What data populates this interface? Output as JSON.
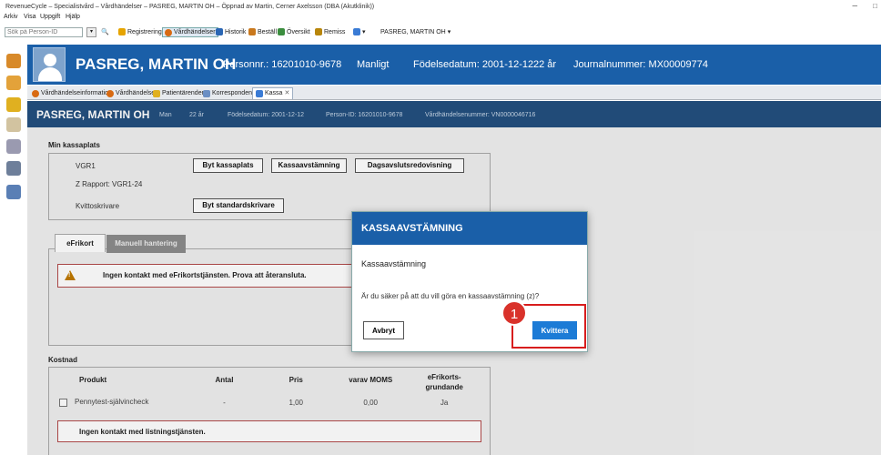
{
  "window": {
    "title": "RevenueCycle – Specialistvård – Vårdhändelser – PASREG, MARTIN OH – Öppnad av Martin, Cerner Axelsson (DBA (Akutklinik))",
    "minimize": "–",
    "close": "□"
  },
  "menu": [
    "Arkiv",
    "Visa",
    "Uppgift",
    "Hjälp"
  ],
  "toolbar": {
    "search_placeholder": "Sök på Person-ID",
    "dropdown": "▾",
    "buttons": [
      "Registrering",
      "Vårdhändelser",
      "Historik",
      "Beställ",
      "Översikt",
      "Remiss",
      "▾",
      "PASREG, MARTIN OH",
      "▾"
    ],
    "colors": [
      "#e6a400",
      "#d86a12",
      "#2a66b4",
      "#c9781d",
      "#3b8d3e",
      "#b8860b",
      "#3a7bd5"
    ]
  },
  "patient": {
    "name": "PASREG, MARTIN OH",
    "personnr": "Personnr.: 16201010-9678",
    "gender": "Manligt",
    "birth": "Födelsedatum: 2001-12-12",
    "age": "22 år",
    "journal": "Journalnummer: MX00009774"
  },
  "tabs": [
    "Vårdhändelseinformation",
    "Vårdhändelser",
    "Patientärenden",
    "Korrespondens",
    "Kassa",
    "✕"
  ],
  "subheader": {
    "name": "PASREG, MARTIN OH",
    "gender": "Man",
    "age": "22 år",
    "birth": "Födelsedatum: 2001-12-12",
    "personid": "Person-ID: 16201010-9678",
    "vardhandelse": "Vårdhändelsenummer: VN0000046716"
  },
  "kassaplats": {
    "title": "Min kassaplats",
    "vgr": "VGR1",
    "zrapport": "Z Rapport: VGR1-24",
    "kvittoskrivare": "Kvittoskrivare",
    "btn_byt": "Byt kassaplats",
    "btn_avstamning": "Kassaavstämning",
    "btn_dagsavslut": "Dagsavslutsredovisning",
    "btn_byt_standard": "Byt standardskrivare"
  },
  "efrikort": {
    "tab1": "eFrikort",
    "tab2": "Manuell hantering",
    "alert": "Ingen kontakt med eFrikortstjänsten. Prova att återansluta."
  },
  "kostnad": {
    "title": "Kostnad",
    "headers": [
      "Produkt",
      "Antal",
      "Pris",
      "varav MOMS",
      "eFrikorts-grundande"
    ],
    "row": [
      "Pennytest-självincheck",
      "-",
      "1,00",
      "0,00",
      "Ja"
    ],
    "alert": "Ingen kontakt med listningstjänsten."
  },
  "dialog": {
    "title": "KASSAAVSTÄMNING",
    "subtitle": "Kassaavstämning",
    "message": "Är du säker på att du vill göra en kassaavstämning (z)?",
    "cancel": "Avbryt",
    "confirm": "Kvittera"
  },
  "annotation": {
    "badge": "1",
    "color": "#d81d1d"
  }
}
